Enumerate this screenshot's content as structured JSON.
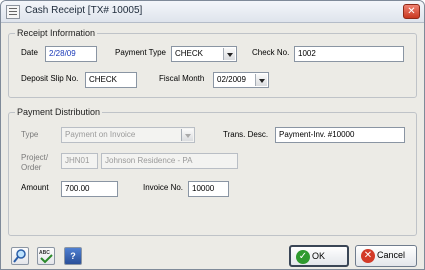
{
  "window": {
    "title": "Cash Receipt [TX# 10005]",
    "close_glyph": "✕"
  },
  "receipt": {
    "legend": "Receipt Information",
    "date_label": "Date",
    "date_value": "2/28/09",
    "payment_type_label": "Payment Type",
    "payment_type_value": "CHECK",
    "check_no_label": "Check No.",
    "check_no_value": "1002",
    "deposit_slip_label": "Deposit Slip No.",
    "deposit_slip_value": "CHECK",
    "fiscal_month_label": "Fiscal Month",
    "fiscal_month_value": "02/2009"
  },
  "distribution": {
    "legend": "Payment Distribution",
    "type_label": "Type",
    "type_value": "Payment on Invoice",
    "trans_desc_label": "Trans. Desc.",
    "trans_desc_value": "Payment-Inv. #10000",
    "project_label_1": "Project/",
    "project_label_2": "Order",
    "project_code": "JHN01",
    "project_name": "Johnson Residence - PA",
    "amount_label": "Amount",
    "amount_value": "700.00",
    "invoice_label": "Invoice No.",
    "invoice_value": "10000"
  },
  "footer": {
    "ok_label": "OK",
    "cancel_label": "Cancel",
    "help_glyph": "?",
    "spell_glyph": "ABC"
  },
  "icons": [
    "app-icon",
    "close-icon",
    "search-icon",
    "spellcheck-icon",
    "help-icon",
    "ok-icon",
    "cancel-icon",
    "dropdown-arrow-icon"
  ]
}
